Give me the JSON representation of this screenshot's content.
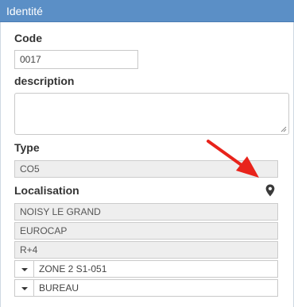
{
  "panel": {
    "title": "Identité"
  },
  "code": {
    "label": "Code",
    "value": "0017"
  },
  "description": {
    "label": "description",
    "value": ""
  },
  "type": {
    "label": "Type",
    "value": "CO5"
  },
  "localisation": {
    "label": "Localisation",
    "levels": [
      "NOISY LE GRAND",
      "EUROCAP",
      "R+4"
    ],
    "zone": "ZONE 2 S1-051",
    "room_type": "BUREAU"
  },
  "colors": {
    "header": "#5b8fc6",
    "arrow": "#e8231b"
  },
  "icons": {
    "map_pin": "map-marker-icon",
    "dropdown": "caret-down-icon"
  }
}
